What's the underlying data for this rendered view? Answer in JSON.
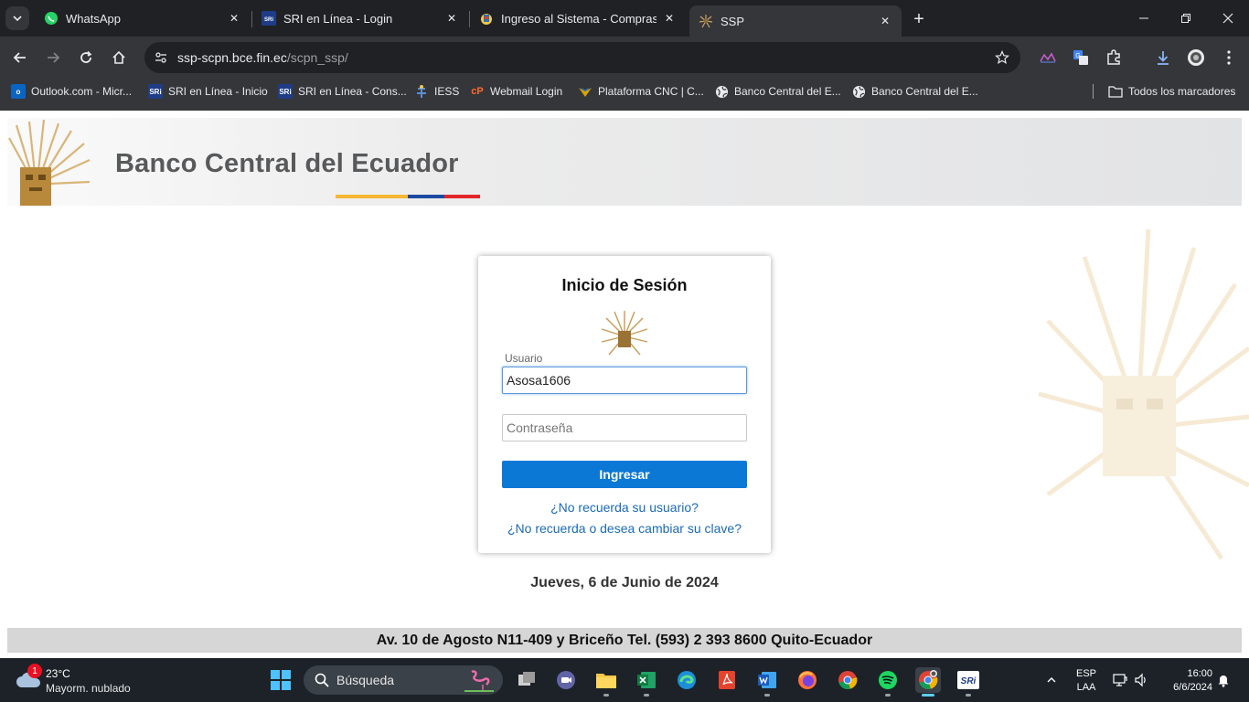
{
  "browser": {
    "tabs": [
      {
        "title": "WhatsApp",
        "icon": "whatsapp-icon"
      },
      {
        "title": "SRI en Línea - Login",
        "icon": "sri-icon"
      },
      {
        "title": "Ingreso al Sistema - Compras P",
        "icon": "ecuador-seal-icon"
      },
      {
        "title": "SSP",
        "icon": "sun-emblem-icon",
        "active": true
      }
    ],
    "url_host": "ssp-scpn.bce.fin.ec",
    "url_path": "/scpn_ssp/",
    "bookmarks": [
      {
        "label": "Outlook.com - Micr...",
        "icon": "outlook-icon",
        "icon_text": "o",
        "color": "#0a64c2"
      },
      {
        "label": "SRI en Línea - Inicio",
        "icon": "sri-icon",
        "icon_text": "SRi",
        "color": "#1f3c88"
      },
      {
        "label": "SRI en Línea - Cons...",
        "icon": "sri-icon",
        "icon_text": "SRi",
        "color": "#1f3c88"
      },
      {
        "label": "IESS",
        "icon": "iess-icon",
        "icon_text": "",
        "color": "#2a5caa"
      },
      {
        "label": "Webmail Login",
        "icon": "cpanel-icon",
        "icon_text": "cP",
        "color": "#ff6c2c"
      },
      {
        "label": "Plataforma CNC | C...",
        "icon": "cnc-icon",
        "icon_text": "",
        "color": "#d9a400"
      },
      {
        "label": "Banco Central del E...",
        "icon": "globe-icon",
        "icon_text": "",
        "color": "#e8eaed"
      },
      {
        "label": "Banco Central del E...",
        "icon": "globe-icon",
        "icon_text": "",
        "color": "#e8eaed"
      }
    ],
    "all_bookmarks": "Todos los marcadores"
  },
  "page": {
    "banner_title": "Banco Central del Ecuador",
    "stripe_colors": [
      "#f5b731",
      "#1c4aa0",
      "#e3262c"
    ],
    "login": {
      "title": "Inicio de Sesión",
      "user_label": "Usuario",
      "user_value": "Asosa1606",
      "password_placeholder": "Contraseña",
      "submit_label": "Ingresar",
      "forgot_user": "¿No recuerda su usuario?",
      "forgot_password": "¿No recuerda o desea cambiar su clave?"
    },
    "date": "Jueves, 6 de Junio de 2024",
    "footer": "Av. 10 de Agosto N11-409 y Briceño Tel. (593) 2 393 8600 Quito-Ecuador"
  },
  "taskbar": {
    "weather_badge": "1",
    "temperature": "23°C",
    "condition": "Mayorm. nublado",
    "search_label": "Búsqueda",
    "lang_top": "ESP",
    "lang_bottom": "LAA",
    "time": "16:00",
    "date": "6/6/2024"
  }
}
